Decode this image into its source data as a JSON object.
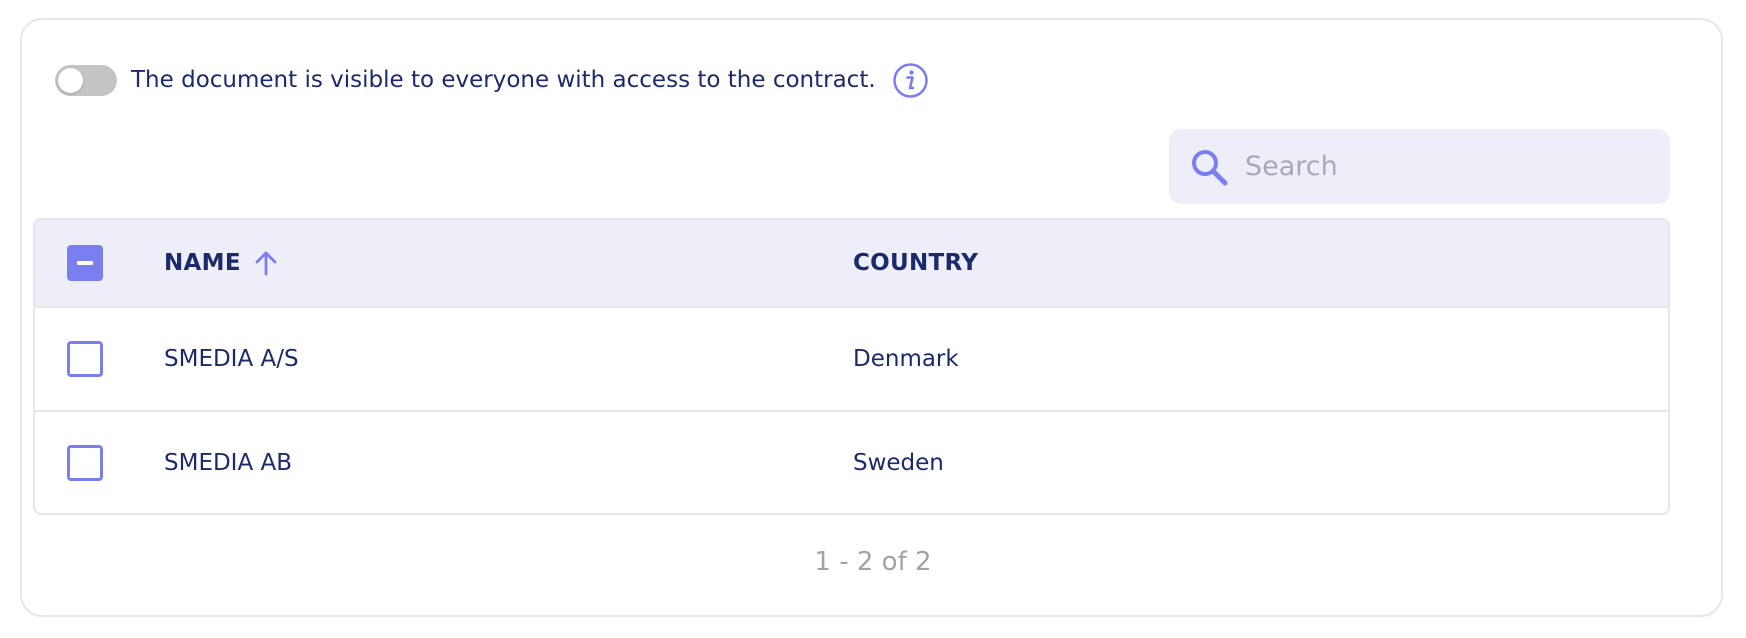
{
  "visibility": {
    "text": "The document is visible to everyone with access to the contract.",
    "toggle_on": false
  },
  "search": {
    "placeholder": "Search",
    "value": ""
  },
  "table": {
    "columns": [
      {
        "label": "NAME",
        "sort": "ascending"
      },
      {
        "label": "COUNTRY"
      }
    ],
    "rows": [
      {
        "name": "SMEDIA A/S",
        "country": "Denmark",
        "checked": false
      },
      {
        "name": "SMEDIA AB",
        "country": "Sweden",
        "checked": false
      }
    ]
  },
  "pagination": {
    "text": "1 - 2 of 2"
  },
  "colors": {
    "accent": "#7a7ff0",
    "text": "#1b2a6b",
    "header_bg": "#eeeef8",
    "muted": "#a0a2ae",
    "toggle_off": "#c4c4c4"
  },
  "icons": {
    "info": "info-icon",
    "search": "search-icon",
    "sort": "arrow-up-icon"
  }
}
